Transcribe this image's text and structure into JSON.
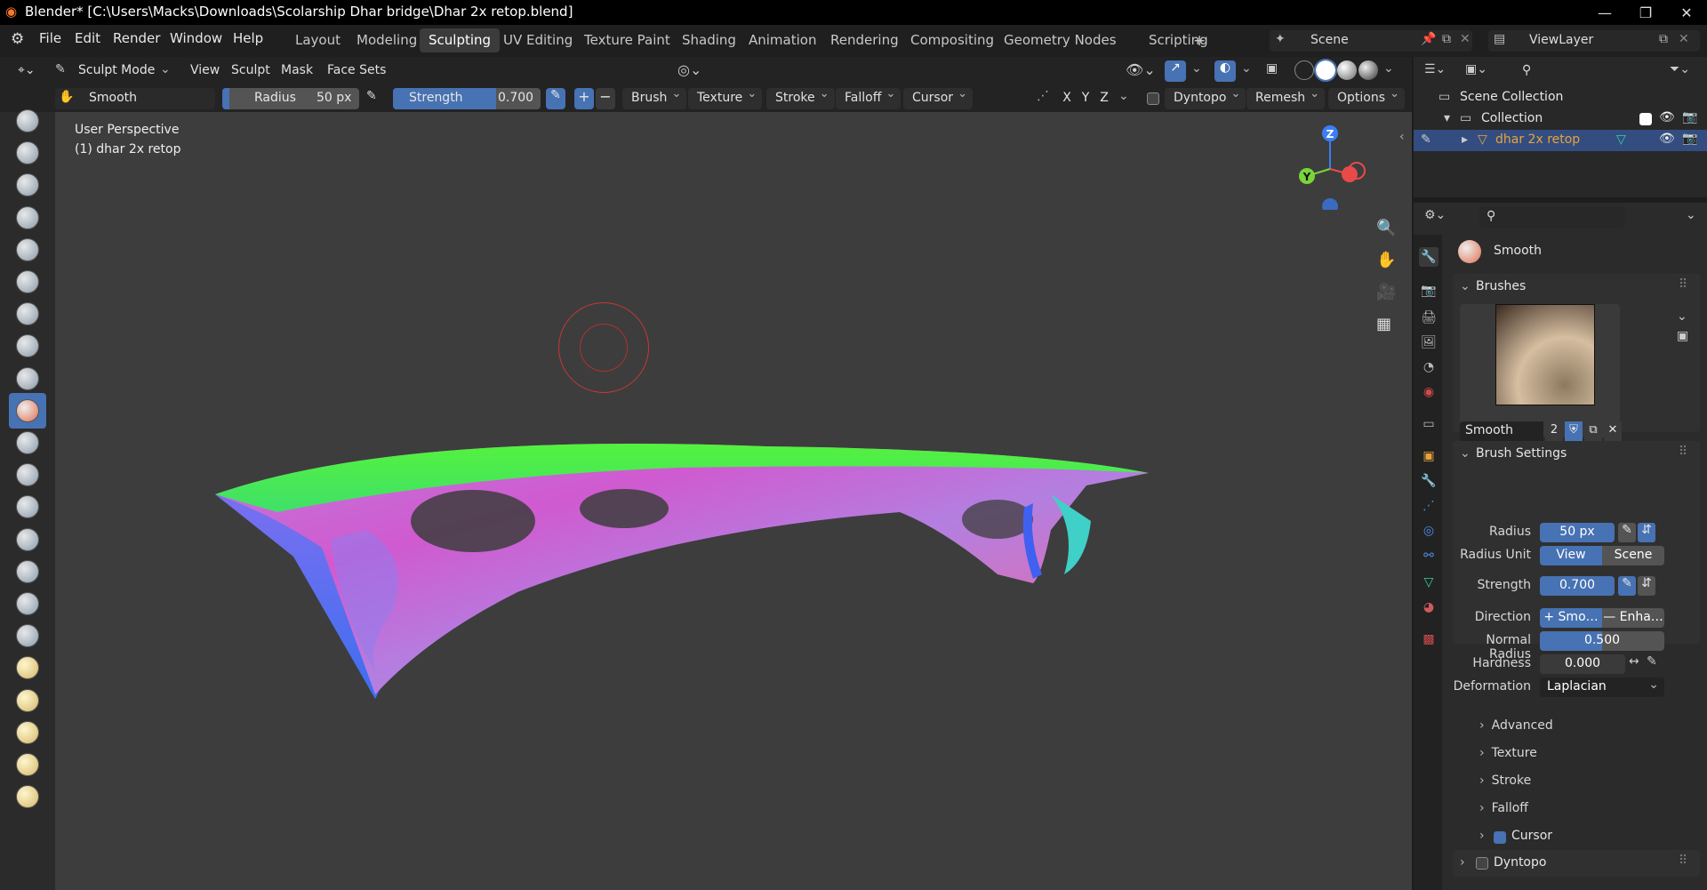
{
  "window": {
    "title": "Blender* [C:\\Users\\Macks\\Downloads\\Scolarship Dhar bridge\\Dhar 2x retop.blend]",
    "minimize": "—",
    "maximize": "❐",
    "close": "✕"
  },
  "menu": {
    "items": [
      "File",
      "Edit",
      "Render",
      "Window",
      "Help"
    ]
  },
  "workspaces": {
    "tabs": [
      "Layout",
      "Modeling",
      "Sculpting",
      "UV Editing",
      "Texture Paint",
      "Shading",
      "Animation",
      "Rendering",
      "Compositing",
      "Geometry Nodes",
      "Scripting"
    ],
    "active": "Sculpting",
    "add": "+"
  },
  "scene": {
    "label": "Scene",
    "view_layer": "ViewLayer"
  },
  "header": {
    "mode": "Sculpt Mode",
    "menus": [
      "View",
      "Sculpt",
      "Mask",
      "Face Sets"
    ]
  },
  "tool_header": {
    "brush_name": "Smooth",
    "radius_label": "Radius",
    "radius_value": "50 px",
    "strength_label": "Strength",
    "strength_value": "0.700",
    "strength_fraction": 0.7,
    "plus": "+",
    "minus": "−",
    "dropdowns": [
      "Brush",
      "Texture",
      "Stroke",
      "Falloff",
      "Cursor"
    ],
    "axes": [
      "X",
      "Y",
      "Z"
    ],
    "dyntopo": "Dyntopo",
    "remesh": "Remesh",
    "options": "Options"
  },
  "viewport": {
    "perspective": "User Perspective",
    "object": "(1) dhar 2x retop",
    "gizmo": {
      "z": "Z",
      "y": "Y"
    }
  },
  "outliner": {
    "scene_collection": "Scene Collection",
    "collection": "Collection",
    "object": "dhar 2x retop"
  },
  "properties": {
    "brush_header": "Smooth",
    "brushes_panel": "Brushes",
    "brush_slot_name": "Smooth",
    "brush_users": "2",
    "brush_settings_panel": "Brush Settings",
    "radius_label": "Radius",
    "radius_value": "50 px",
    "radius_unit_label": "Radius Unit",
    "radius_unit_view": "View",
    "radius_unit_scene": "Scene",
    "strength_label": "Strength",
    "strength_value": "0.700",
    "direction_label": "Direction",
    "direction_smooth": "+ Smo…",
    "direction_enhance": "— Enha…",
    "normal_radius_label": "Normal Radius",
    "normal_radius_value": "0.500",
    "normal_radius_fraction": 0.5,
    "hardness_label": "Hardness",
    "hardness_value": "0.000",
    "deformation_label": "Deformation",
    "deformation_value": "Laplacian",
    "subpanels": [
      "Advanced",
      "Texture",
      "Stroke",
      "Falloff"
    ],
    "cursor_label": "Cursor",
    "cursor_checked": true,
    "dyntopo_label": "Dyntopo",
    "dyntopo_checked": false
  },
  "colors": {
    "accent": "#4772b3",
    "active_object": "#e8a33c",
    "viewport_bg": "#3d3d3d"
  }
}
